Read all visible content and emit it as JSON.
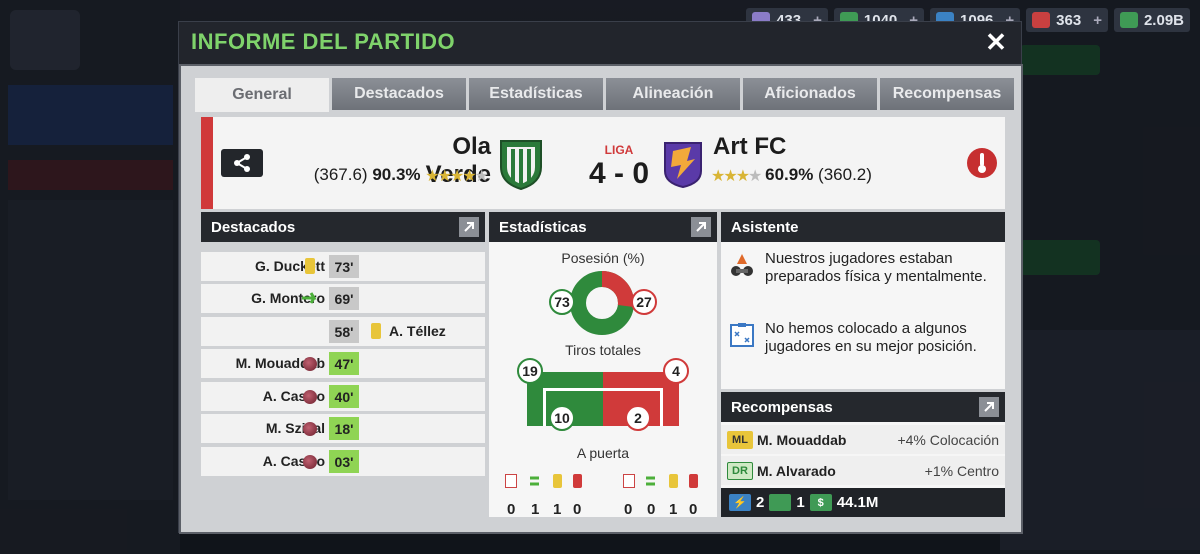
{
  "topbar": {
    "currencies": [
      {
        "value": "433",
        "icon": "token-icon",
        "color": "#8b7cc8"
      },
      {
        "value": "1040",
        "icon": "coin-icon",
        "color": "#3f9a55"
      },
      {
        "value": "1096",
        "icon": "energy-icon",
        "color": "#3b82c4"
      },
      {
        "value": "363",
        "icon": "medkit-icon",
        "color": "#c84040"
      },
      {
        "value": "2.09B",
        "icon": "cash-icon",
        "color": "#3f9a55"
      }
    ],
    "plus": "+"
  },
  "modal": {
    "title": "INFORME DEL PARTIDO",
    "close": "✕"
  },
  "tabs": [
    "General",
    "Destacados",
    "Estadísticas",
    "Alineación",
    "Aficionados",
    "Recompensas"
  ],
  "match": {
    "home": {
      "name": "Ola Verde",
      "rating": "(367.6)",
      "percent": "90.3%",
      "stars": 4.5
    },
    "away": {
      "name": "Art FC",
      "rating": "(360.2)",
      "percent": "60.9%",
      "stars": 3.5
    },
    "competition": "LIGA",
    "score": "4 - 0"
  },
  "destacados": {
    "title": "Destacados",
    "rows": [
      {
        "player": "G. Duckett",
        "event": "yellow-card-icon",
        "minute": "73'",
        "side": "home"
      },
      {
        "player": "G. Montero",
        "event": "substitution-icon",
        "minute": "69'",
        "side": "home"
      },
      {
        "player": "A. Téllez",
        "event": "yellow-card-icon",
        "minute": "58'",
        "side": "away"
      },
      {
        "player": "M. Mouaddab",
        "event": "goal-icon",
        "minute": "47'",
        "side": "home"
      },
      {
        "player": "A. Castro",
        "event": "goal-icon",
        "minute": "40'",
        "side": "home"
      },
      {
        "player": "M. Szikal",
        "event": "goal-icon",
        "minute": "18'",
        "side": "home"
      },
      {
        "player": "A. Castro",
        "event": "goal-icon",
        "minute": "03'",
        "side": "home"
      }
    ]
  },
  "estadisticas": {
    "title": "Estadísticas",
    "possession_label": "Posesión (%)",
    "possession_home": "73",
    "possession_away": "27",
    "shots_label": "Tiros totales",
    "shots_home": "19",
    "shots_away": "4",
    "on_target_home": "10",
    "on_target_away": "2",
    "on_target_label": "A puerta",
    "home_counts": [
      "0",
      "1",
      "1",
      "0"
    ],
    "away_counts": [
      "0",
      "0",
      "1",
      "0"
    ],
    "count_icons": [
      "injury-icon",
      "substitution-icon",
      "yellow-card-icon",
      "red-card-icon"
    ],
    "colors": {
      "home": "#2f8a3c",
      "away": "#d03a3a"
    }
  },
  "asistente": {
    "title": "Asistente",
    "messages": [
      {
        "icon": "fitness-icon",
        "text": "Nuestros jugadores estaban preparados física y mentalmente."
      },
      {
        "icon": "tactics-board-icon",
        "text": "No hemos colocado a algunos jugadores en su mejor posición."
      }
    ]
  },
  "recompensas": {
    "title": "Recompensas",
    "rows": [
      {
        "position": "ML",
        "player": "M. Mouaddab",
        "value": "+4% Colocación"
      },
      {
        "position": "DR",
        "player": "M. Alvarado",
        "value": "+1% Centro"
      }
    ],
    "totals": [
      {
        "icon": "energy-icon",
        "value": "2"
      },
      {
        "icon": "coin-icon",
        "value": "1"
      },
      {
        "icon": "cash-icon",
        "value": "44.1M"
      }
    ]
  }
}
